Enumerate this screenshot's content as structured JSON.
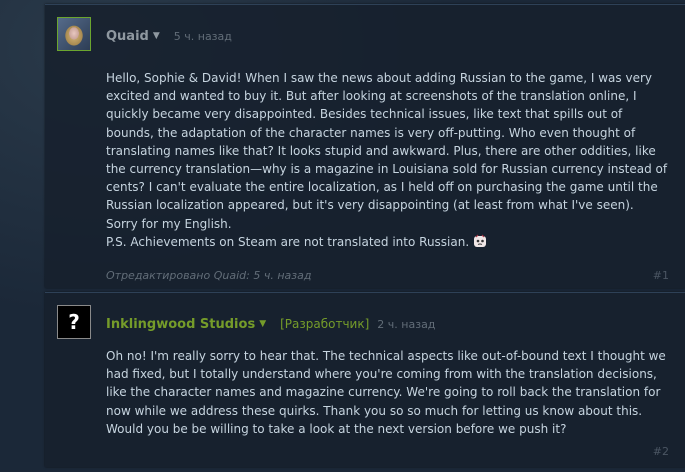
{
  "comments": [
    {
      "author": "Quaid",
      "timestamp": "5 ч. назад",
      "body": "Hello, Sophie & David! When I saw the news about adding Russian to the game, I was very excited and wanted to buy it. But after looking at screenshots of the translation online, I quickly became very disappointed. Besides technical issues, like text that spills out of bounds, the adaptation of the character names is very off-putting. Who even thought of translating names like that? It looks stupid and awkward. Plus, there are other oddities, like the currency translation—why is a magazine in Louisiana sold for Russian currency instead of cents? I can't evaluate the entire localization, as I held off on purchasing the game until the Russian localization appeared, but it's very disappointing (at least from what I've seen). Sorry for my English.",
      "ps": "P.S. Achievements on Steam are not translated into Russian.",
      "edited": "Отредактировано Quaid: 5 ч. назад",
      "number": "#1"
    },
    {
      "author": "Inklingwood Studios",
      "badge": "[Разработчик]",
      "timestamp": "2 ч. назад",
      "avatar_glyph": "?",
      "body": "Oh no! I'm really sorry to hear that. The technical aspects like out-of-bound text I thought we had fixed, but I totally understand where you're coming from with the translation decisions, like the character names and magazine currency. We're going to roll back the translation for now while we address these quirks. Thank you so so much for letting us know about this. Would you be be willing to take a look at the next version before we push it?",
      "number": "#2"
    }
  ],
  "colors": {
    "background": "#1b2838",
    "text": "#c6d4df",
    "developer": "#759c2a",
    "muted": "#626d78"
  }
}
